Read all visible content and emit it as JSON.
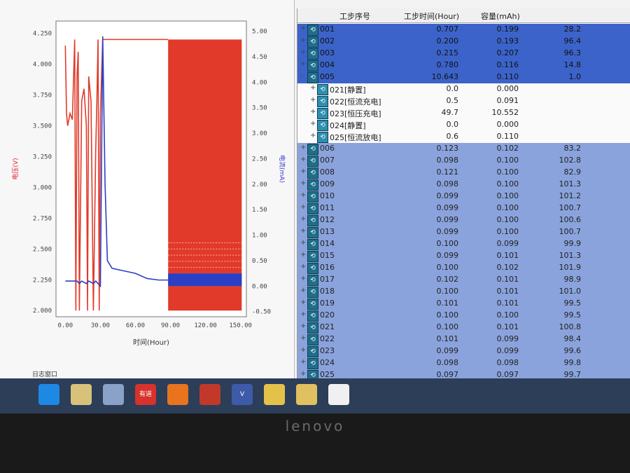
{
  "window": {
    "log_window_label": "日志窗口"
  },
  "chart_data": {
    "type": "line",
    "xlabel": "时间(Hour)",
    "ylabel_left": "电压(V)",
    "ylabel_right": "电流(mA)",
    "x_ticks": [
      "0.00",
      "30.00",
      "60.00",
      "90.00",
      "120.00",
      "150.00"
    ],
    "y_left_ticks": [
      "2.000",
      "2.250",
      "2.500",
      "2.750",
      "3.000",
      "3.250",
      "3.500",
      "3.750",
      "4.000",
      "4.250"
    ],
    "y_right_ticks": [
      "-0.50",
      "0.00",
      "0.50",
      "1.00",
      "1.50",
      "2.00",
      "2.50",
      "3.00",
      "3.50",
      "4.00",
      "4.50",
      "5.00"
    ],
    "xlim": [
      -8,
      155
    ],
    "ylim_left": [
      1.95,
      4.35
    ],
    "ylim_right": [
      -0.6,
      5.2
    ],
    "series": [
      {
        "name": "电压(V)",
        "color": "#e23a2a",
        "x": [
          0,
          1,
          2,
          4,
          6,
          8,
          9,
          10,
          11,
          12,
          14,
          16,
          18,
          19,
          20,
          22,
          24,
          26,
          27,
          28,
          29,
          30,
          32,
          35,
          40,
          60,
          80,
          88
        ],
        "y": [
          4.15,
          3.6,
          3.5,
          3.6,
          3.55,
          4.2,
          2.0,
          3.9,
          4.1,
          2.0,
          3.7,
          3.8,
          3.5,
          2.0,
          3.9,
          3.7,
          2.0,
          3.3,
          3.7,
          4.2,
          2.0,
          3.6,
          4.2,
          4.2,
          4.2,
          4.2,
          4.2,
          4.2
        ]
      },
      {
        "name": "电流(mA)",
        "color": "#2b3fc4",
        "x": [
          0,
          5,
          10,
          12,
          14,
          18,
          20,
          24,
          26,
          28,
          30,
          32,
          34,
          36,
          40,
          50,
          60,
          70,
          80,
          88
        ],
        "y": [
          0.1,
          0.1,
          0.1,
          0.05,
          0.1,
          0.05,
          0.1,
          0.05,
          0.1,
          0.05,
          0.0,
          4.9,
          2.0,
          0.5,
          0.35,
          0.3,
          0.25,
          0.15,
          0.12,
          0.12
        ]
      }
    ],
    "dense_region": {
      "x_start": 88,
      "x_end": 151,
      "voltage_range": [
        2.0,
        4.2
      ],
      "current_range": [
        0.0,
        0.25
      ]
    }
  },
  "table": {
    "headers": {
      "step": "工步序号",
      "time": "工步时间(Hour)",
      "capacity": "容量(mAh)",
      "col4": ""
    },
    "rows": [
      {
        "exp": "+",
        "name": "001",
        "time": "0.707",
        "cap": "0.199",
        "extra": "28.2",
        "style": "sel",
        "child": false
      },
      {
        "exp": "+",
        "name": "002",
        "time": "0.200",
        "cap": "0.193",
        "extra": "96.4",
        "style": "sel",
        "child": false
      },
      {
        "exp": "+",
        "name": "003",
        "time": "0.215",
        "cap": "0.207",
        "extra": "96.3",
        "style": "sel",
        "child": false
      },
      {
        "exp": "+",
        "name": "004",
        "time": "0.780",
        "cap": "0.116",
        "extra": "14.8",
        "style": "sel",
        "child": false
      },
      {
        "exp": "-",
        "name": "005",
        "time": "10.643",
        "cap": "0.110",
        "extra": "1.0",
        "style": "sel",
        "child": false
      },
      {
        "exp": "+",
        "name": "021[静置]",
        "time": "0.0",
        "cap": "0.000",
        "extra": "",
        "style": "light",
        "child": true
      },
      {
        "exp": "+",
        "name": "022[恒流充电]",
        "time": "0.5",
        "cap": "0.091",
        "extra": "",
        "style": "light",
        "child": true
      },
      {
        "exp": "+",
        "name": "023[恒压充电]",
        "time": "49.7",
        "cap": "10.552",
        "extra": "",
        "style": "light",
        "child": true
      },
      {
        "exp": "+",
        "name": "024[静置]",
        "time": "0.0",
        "cap": "0.000",
        "extra": "",
        "style": "light",
        "child": true
      },
      {
        "exp": "+",
        "name": "025[恒流放电]",
        "time": "0.6",
        "cap": "0.110",
        "extra": "",
        "style": "light",
        "child": true
      },
      {
        "exp": "+",
        "name": "006",
        "time": "0.123",
        "cap": "0.102",
        "extra": "83.2",
        "style": "blue",
        "child": false
      },
      {
        "exp": "+",
        "name": "007",
        "time": "0.098",
        "cap": "0.100",
        "extra": "102.8",
        "style": "blue",
        "child": false
      },
      {
        "exp": "+",
        "name": "008",
        "time": "0.121",
        "cap": "0.100",
        "extra": "82.9",
        "style": "blue",
        "child": false
      },
      {
        "exp": "+",
        "name": "009",
        "time": "0.098",
        "cap": "0.100",
        "extra": "101.3",
        "style": "blue",
        "child": false
      },
      {
        "exp": "+",
        "name": "010",
        "time": "0.099",
        "cap": "0.100",
        "extra": "101.2",
        "style": "blue",
        "child": false
      },
      {
        "exp": "+",
        "name": "011",
        "time": "0.099",
        "cap": "0.100",
        "extra": "100.7",
        "style": "blue",
        "child": false
      },
      {
        "exp": "+",
        "name": "012",
        "time": "0.099",
        "cap": "0.100",
        "extra": "100.6",
        "style": "blue",
        "child": false
      },
      {
        "exp": "+",
        "name": "013",
        "time": "0.099",
        "cap": "0.100",
        "extra": "100.7",
        "style": "blue",
        "child": false
      },
      {
        "exp": "+",
        "name": "014",
        "time": "0.100",
        "cap": "0.099",
        "extra": "99.9",
        "style": "blue",
        "child": false
      },
      {
        "exp": "+",
        "name": "015",
        "time": "0.099",
        "cap": "0.101",
        "extra": "101.3",
        "style": "blue",
        "child": false
      },
      {
        "exp": "+",
        "name": "016",
        "time": "0.100",
        "cap": "0.102",
        "extra": "101.9",
        "style": "blue",
        "child": false
      },
      {
        "exp": "+",
        "name": "017",
        "time": "0.102",
        "cap": "0.101",
        "extra": "98.9",
        "style": "blue",
        "child": false
      },
      {
        "exp": "+",
        "name": "018",
        "time": "0.100",
        "cap": "0.101",
        "extra": "101.0",
        "style": "blue",
        "child": false
      },
      {
        "exp": "+",
        "name": "019",
        "time": "0.101",
        "cap": "0.101",
        "extra": "99.5",
        "style": "blue",
        "child": false
      },
      {
        "exp": "+",
        "name": "020",
        "time": "0.100",
        "cap": "0.100",
        "extra": "99.5",
        "style": "blue",
        "child": false
      },
      {
        "exp": "+",
        "name": "021",
        "time": "0.100",
        "cap": "0.101",
        "extra": "100.8",
        "style": "blue",
        "child": false
      },
      {
        "exp": "+",
        "name": "022",
        "time": "0.101",
        "cap": "0.099",
        "extra": "98.4",
        "style": "blue",
        "child": false
      },
      {
        "exp": "+",
        "name": "023",
        "time": "0.099",
        "cap": "0.099",
        "extra": "99.6",
        "style": "blue",
        "child": false
      },
      {
        "exp": "+",
        "name": "024",
        "time": "0.098",
        "cap": "0.098",
        "extra": "99.8",
        "style": "blue",
        "child": false
      },
      {
        "exp": "+",
        "name": "025",
        "time": "0.097",
        "cap": "0.097",
        "extra": "99.7",
        "style": "blue",
        "child": false
      }
    ]
  },
  "taskbar": {
    "items": [
      {
        "icon": "windows-start-icon",
        "label": "",
        "color": "#1e88e5"
      },
      {
        "icon": "folder-icon",
        "label": "",
        "color": "#d8c27a"
      },
      {
        "icon": "battery-test-app-icon",
        "label": "",
        "color": "#8aa1c8"
      },
      {
        "icon": "app-red-icon",
        "label": "有道",
        "color": "#d7322b"
      },
      {
        "icon": "firefox-icon",
        "label": "",
        "color": "#e8741e"
      },
      {
        "icon": "pdf-icon",
        "label": "",
        "color": "#c0392b"
      },
      {
        "icon": "visio-icon",
        "label": "V",
        "color": "#3d5ba9"
      },
      {
        "icon": "media-icon",
        "label": "",
        "color": "#e3c24a"
      },
      {
        "icon": "file-icon",
        "label": "",
        "color": "#e0c060"
      },
      {
        "icon": "waveform-icon",
        "label": "",
        "color": "#f0f0f0"
      }
    ]
  },
  "bezel": {
    "brand": "lenovo"
  }
}
